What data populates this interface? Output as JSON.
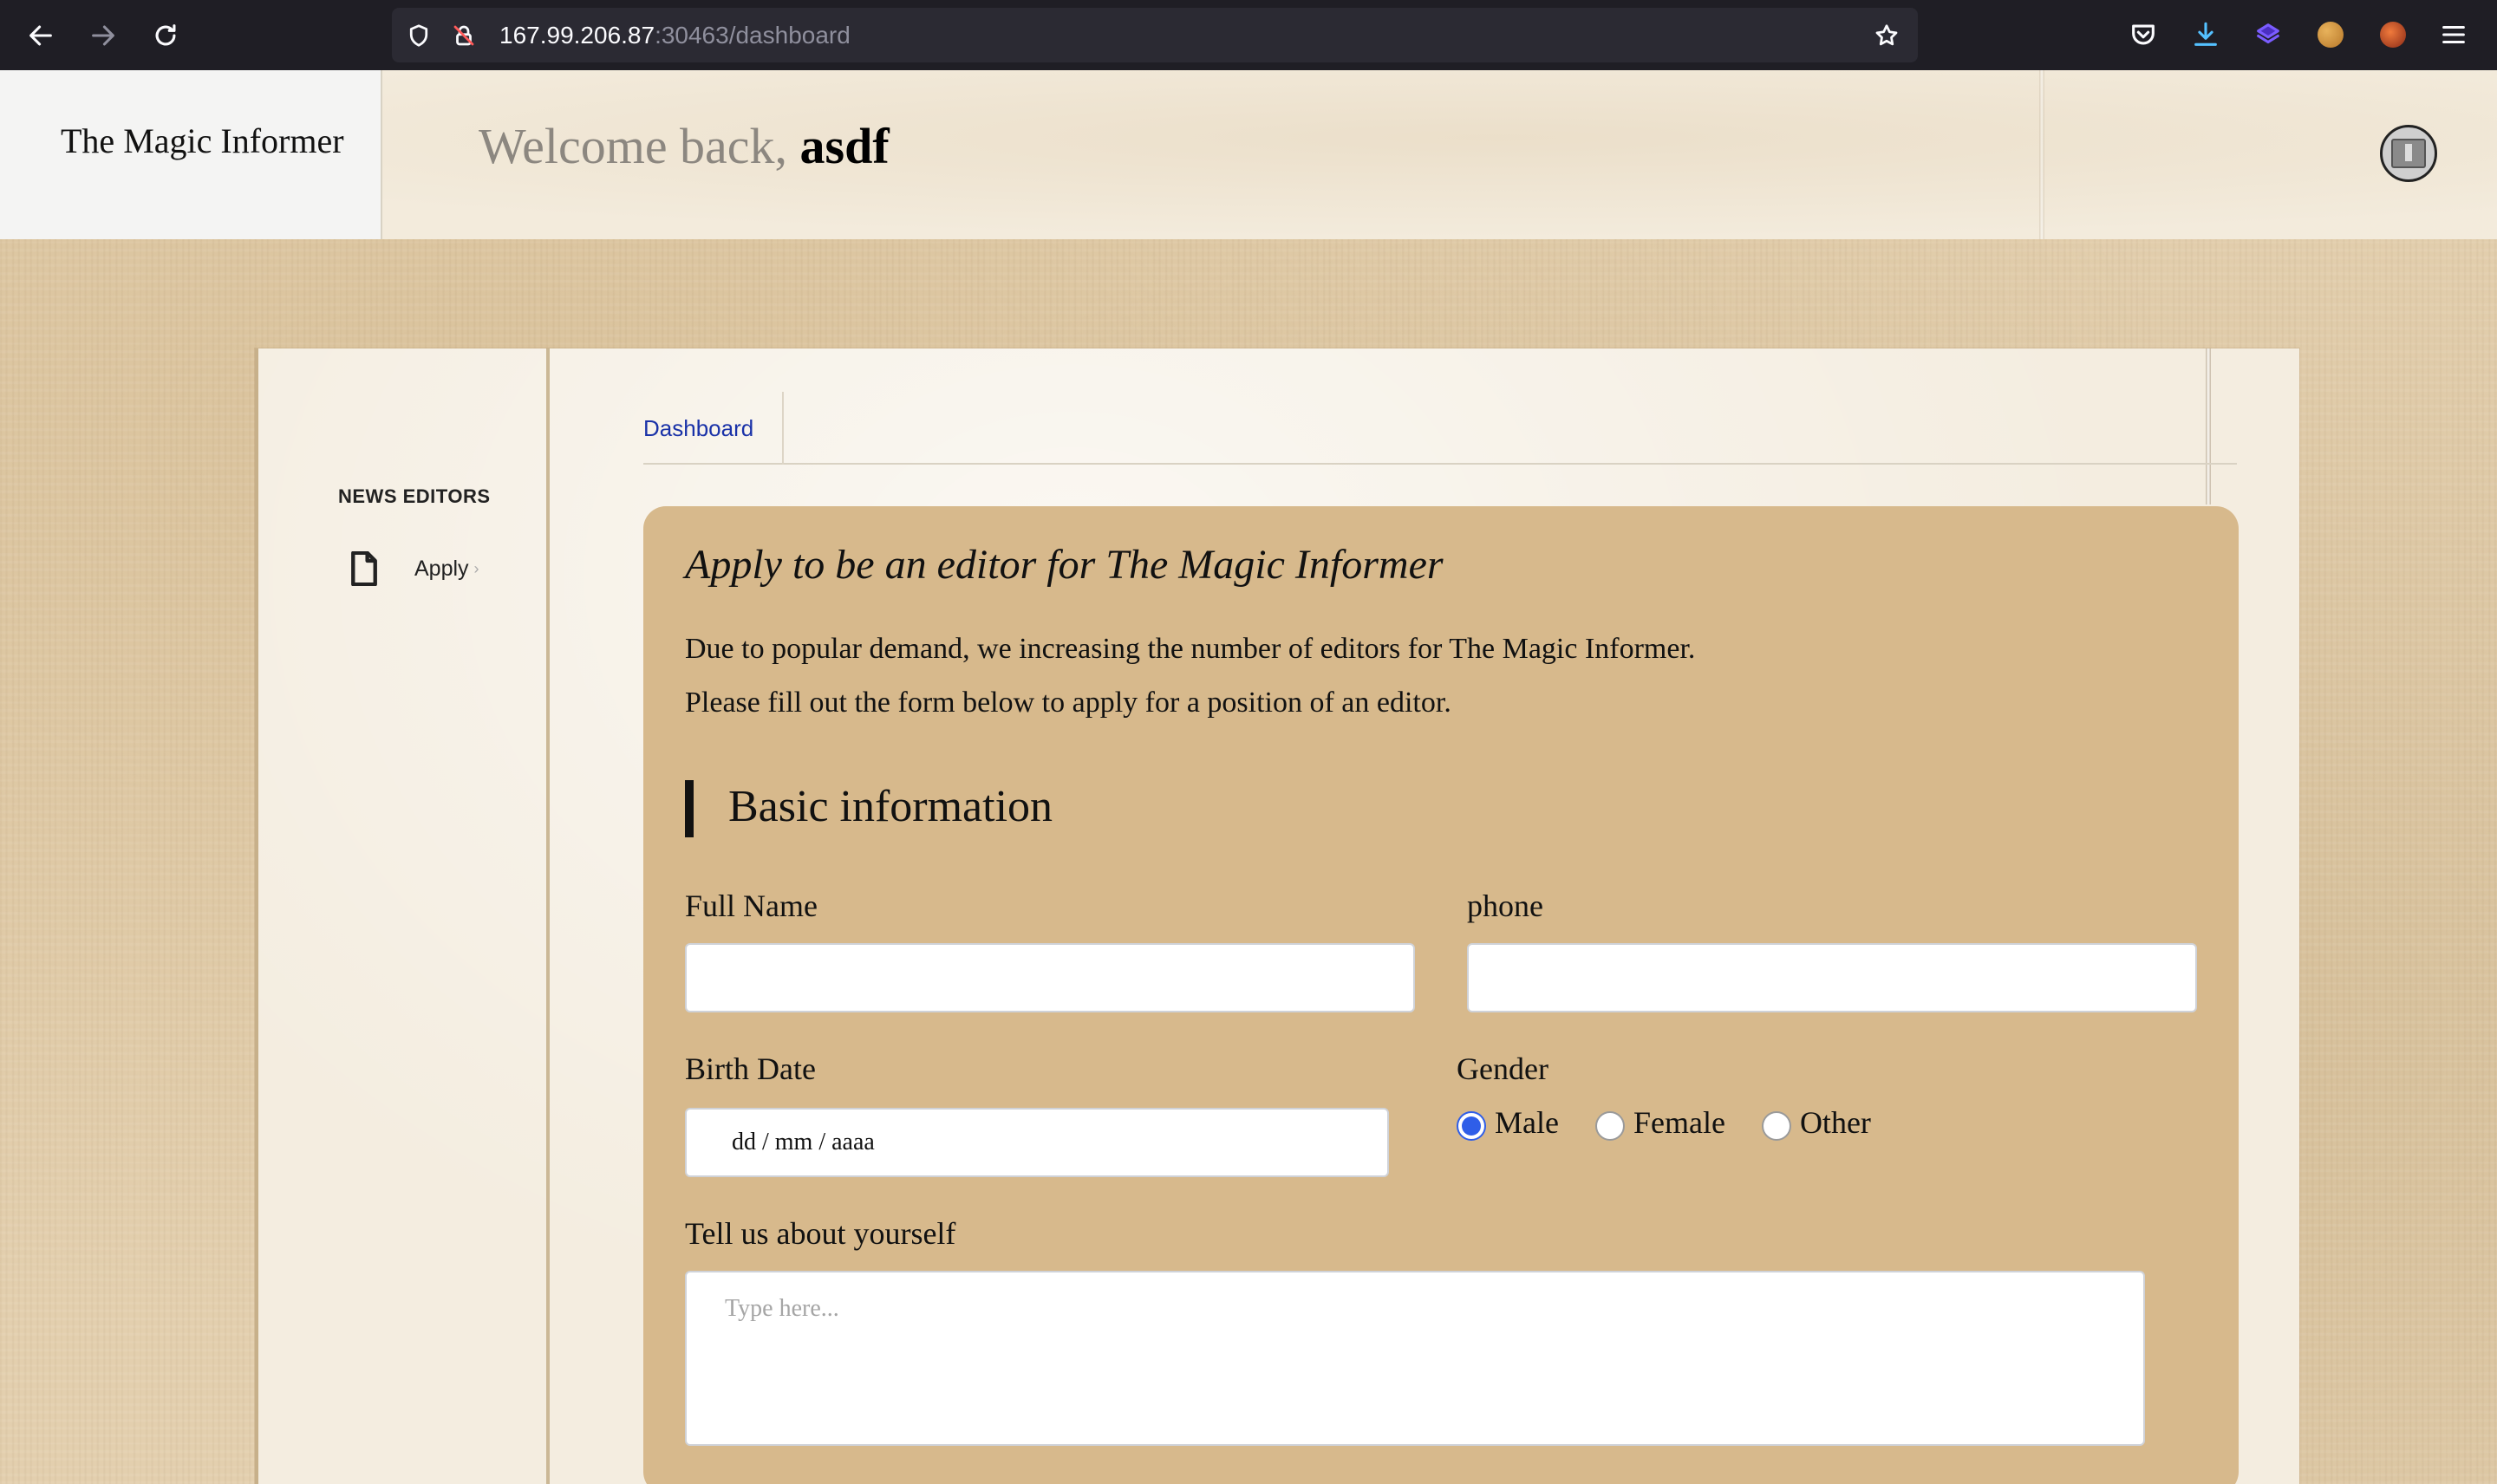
{
  "browser": {
    "url_host": "167.99.206.87",
    "url_path": ":30463/dashboard",
    "icons": [
      "back-icon",
      "forward-icon",
      "reload-icon",
      "shield-icon",
      "insecure-lock-icon",
      "bookmark-star-icon",
      "pocket-icon",
      "download-icon",
      "extension-icon",
      "cookie-icon",
      "profile-icon",
      "menu-icon"
    ]
  },
  "header": {
    "brand": "The Magic Informer",
    "welcome_prefix": "Welcome back, ",
    "username": "asdf"
  },
  "sidebar": {
    "heading": "NEWS EDITORS",
    "items": [
      {
        "label": "Apply",
        "icon": "document-icon"
      }
    ]
  },
  "tabs": [
    {
      "label": "Dashboard"
    }
  ],
  "form": {
    "title": "Apply to be an editor for The Magic Informer",
    "intro_line1": "Due to popular demand, we increasing the number of editors for The Magic Informer.",
    "intro_line2": "Please fill out the form below to apply for a position of an editor.",
    "section": "Basic information",
    "full_name_label": "Full Name",
    "full_name_value": "",
    "phone_label": "phone",
    "phone_value": "",
    "birth_date_label": "Birth Date",
    "birth_date_placeholder": "dd / mm / aaaa",
    "gender_label": "Gender",
    "gender_options": [
      "Male",
      "Female",
      "Other"
    ],
    "gender_selected": "Male",
    "about_label": "Tell us about yourself",
    "about_placeholder": "Type here..."
  },
  "colors": {
    "browser_bg": "#1f1e25",
    "url_bar_bg": "#2b2a33",
    "panel_bg": "#d7b98c",
    "link_blue": "#1a32a8",
    "radio_blue": "#2f5ee8"
  }
}
